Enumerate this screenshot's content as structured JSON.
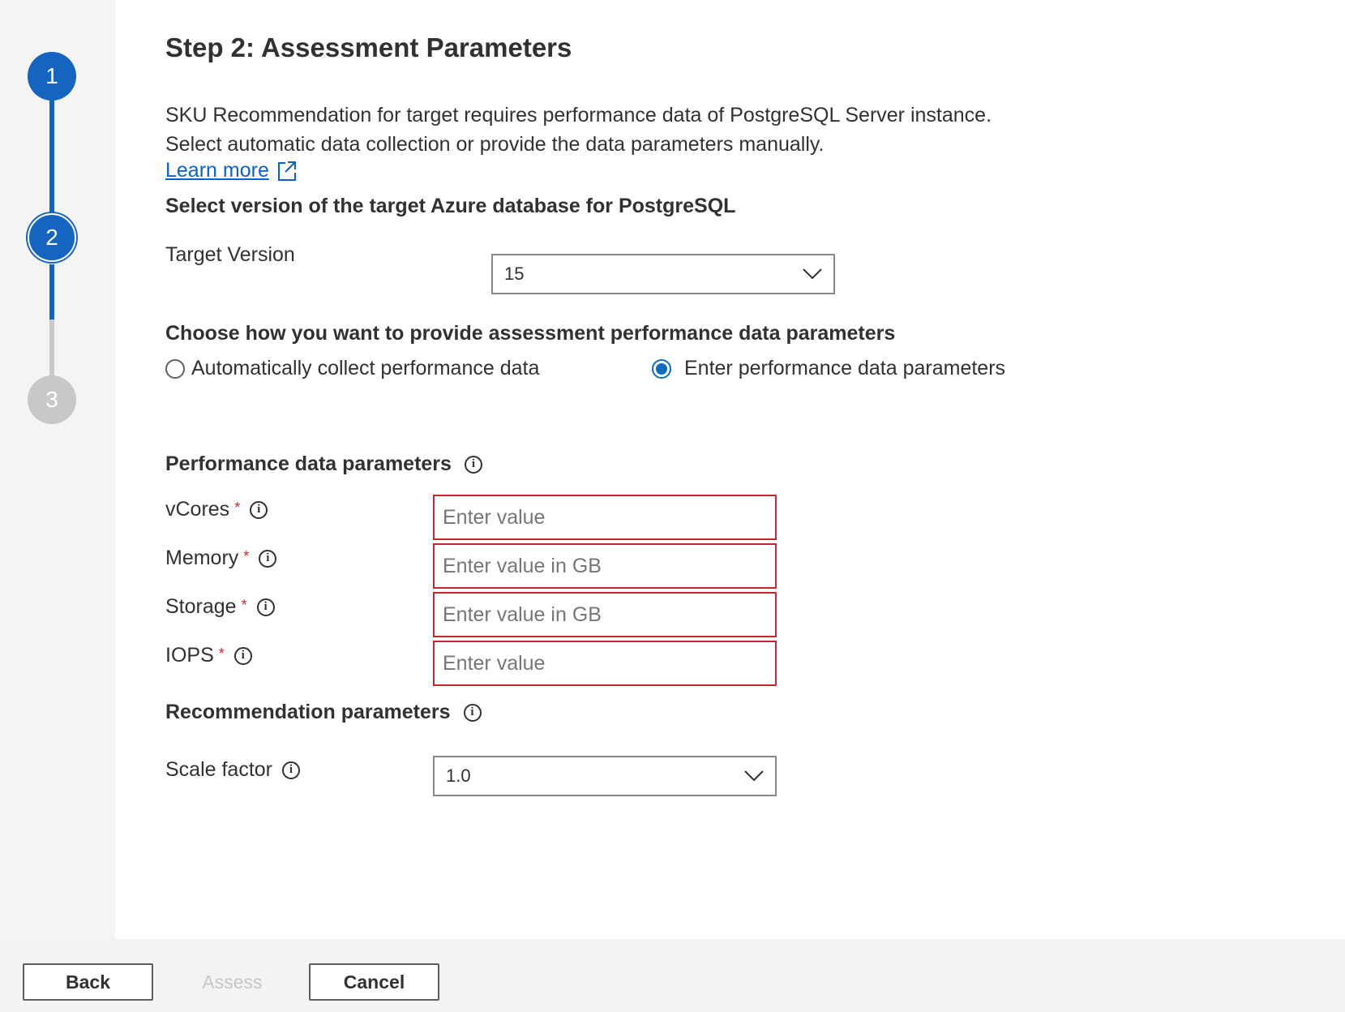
{
  "stepper": {
    "steps": [
      {
        "number": "1",
        "state": "completed"
      },
      {
        "number": "2",
        "state": "current"
      },
      {
        "number": "3",
        "state": "upcoming"
      }
    ],
    "accent_color": "#1565c0"
  },
  "main": {
    "title": "Step 2: Assessment Parameters",
    "description_line1": "SKU Recommendation for target requires performance data of PostgreSQL Server instance.",
    "description_line2": "Select automatic data collection or provide the data parameters manually.",
    "learn_more": "Learn more",
    "version_heading": "Select version of the target Azure database for PostgreSQL",
    "target_version_label": "Target Version",
    "target_version_value": "15",
    "method_heading": "Choose how you want to provide assessment performance data parameters",
    "radio_auto_label": "Automatically collect performance data",
    "radio_manual_label": "Enter performance data parameters",
    "selected_method": "manual",
    "perf_heading": "Performance data parameters",
    "fields": [
      {
        "label": "vCores",
        "required": "*",
        "placeholder": "Enter value"
      },
      {
        "label": "Memory",
        "required": "*",
        "placeholder": "Enter value in GB"
      },
      {
        "label": "Storage",
        "required": "*",
        "placeholder": "Enter value in GB"
      },
      {
        "label": "IOPS",
        "required": "*",
        "placeholder": "Enter value"
      }
    ],
    "recommendation_heading": "Recommendation parameters",
    "scale_factor_label": "Scale factor",
    "scale_factor_value": "1.0",
    "error_color": "#c4262e",
    "link_color": "#0a61c8"
  },
  "footer": {
    "back_label": "Back",
    "assess_label": "Assess",
    "cancel_label": "Cancel"
  }
}
